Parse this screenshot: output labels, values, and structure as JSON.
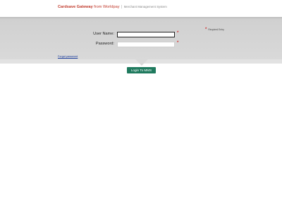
{
  "header": {
    "brand_name": "Cardsave Gateway",
    "brand_from": "from Worldpay",
    "separator": "|",
    "subtitle": "Merchant Management System"
  },
  "form": {
    "username_label": "User Name:",
    "username_value": "",
    "password_label": "Password:",
    "password_value": "",
    "required_marker": "*",
    "required_note": "Required Entry",
    "forgot_password": "Forgot password",
    "login_button": "Login To MMS"
  },
  "colors": {
    "brand_red": "#c0392b",
    "button_green": "#1f7a5e",
    "required_red": "#d32f2f"
  }
}
